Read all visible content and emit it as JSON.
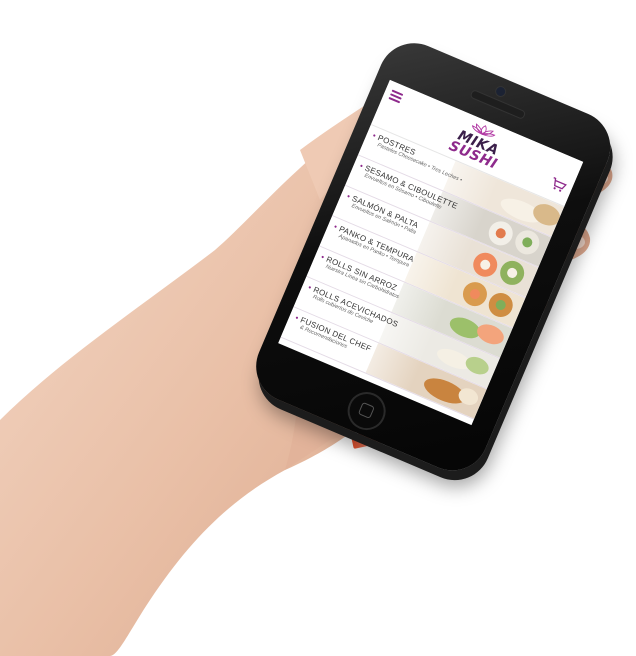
{
  "app": {
    "logo_line1": "MIKA",
    "logo_line2": "SUSHI",
    "accent_color": "#8e2a8c",
    "icons": [
      "menu-icon",
      "lotus-logo-icon",
      "cart-icon"
    ]
  },
  "menu": {
    "items": [
      {
        "name": "POSTRES",
        "desc": "Pasteles Cheesecake • Tres Leches •"
      },
      {
        "name": "SESAMO & CIBOULETTE",
        "desc": "Envueltos en Sésamo • Ciboulette"
      },
      {
        "name": "SALMÓN & PALTA",
        "desc": "Envueltos en Salmón • Palta"
      },
      {
        "name": "PANKO & TEMPURA",
        "desc": "Apanados en Panko • Tempura"
      },
      {
        "name": "ROLLS SIN ARROZ",
        "desc": "Nuestra Línea sin Carbohidratos"
      },
      {
        "name": "ROLLS ACEVICHADOS",
        "desc": "Rolls cubiertos de Ceviche"
      },
      {
        "name": "FUSION DEL CHEF",
        "desc": "& Recomendaciones"
      }
    ]
  }
}
